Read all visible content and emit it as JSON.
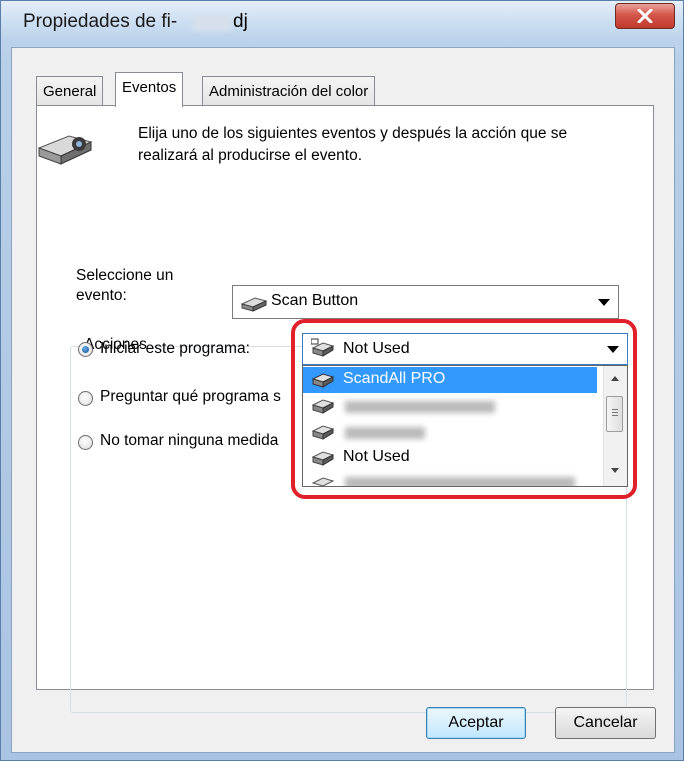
{
  "window": {
    "title_prefix": "Propiedades de fi-",
    "title_suffix": "dj",
    "close_label": "X"
  },
  "tabs": [
    {
      "label": "General"
    },
    {
      "label": "Eventos"
    },
    {
      "label": "Administración del color"
    }
  ],
  "active_tab": "Eventos",
  "intro": {
    "line1": "Elija uno de los siguientes eventos y después la acción que se",
    "line2": "realizará al producirse el evento."
  },
  "event_select": {
    "label_line1": "Seleccione un",
    "label_line2": "evento:",
    "value": "Scan Button"
  },
  "actions": {
    "group_label": "Acciones",
    "options": [
      {
        "label": "Iniciar este programa:",
        "checked": true
      },
      {
        "label": "Preguntar qué programa s",
        "checked": false
      },
      {
        "label": "No tomar ninguna medida",
        "checked": false
      }
    ]
  },
  "program_select": {
    "value": "Not Used",
    "items": [
      {
        "label": "ScandAll PRO",
        "selected": true
      },
      {
        "label": "",
        "blurred": true
      },
      {
        "label": "",
        "blurred": true
      },
      {
        "label": "Not Used"
      },
      {
        "label": "",
        "blurred": true
      }
    ]
  },
  "buttons": {
    "ok": "Aceptar",
    "cancel": "Cancelar"
  },
  "colors": {
    "highlight": "#e0202a",
    "selection": "#3399ff"
  }
}
